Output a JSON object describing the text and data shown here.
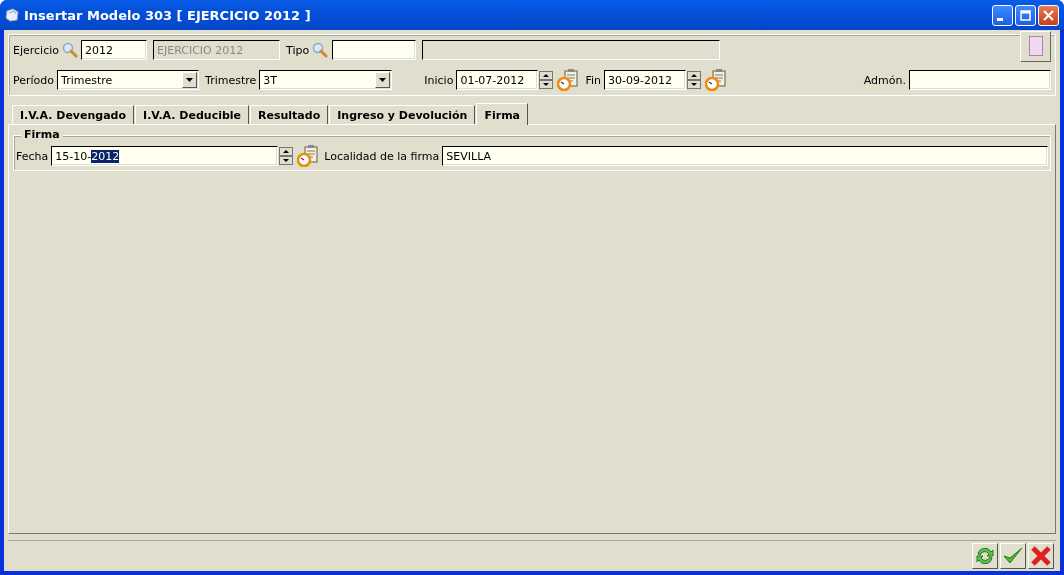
{
  "window": {
    "title": "Insertar Modelo 303 [ EJERCICIO 2012 ]"
  },
  "header": {
    "ejercicio": {
      "label": "Ejercicio",
      "value": "2012",
      "description": "EJERCICIO 2012"
    },
    "tipo": {
      "label": "Tipo"
    },
    "periodo": {
      "label": "Período",
      "value": "Trimestre"
    },
    "trimestre": {
      "label": "Trimestre",
      "value": "3T"
    },
    "inicio": {
      "label": "Inicio",
      "value": "01-07-2012"
    },
    "fin": {
      "label": "Fin",
      "value": "30-09-2012"
    },
    "admon": {
      "label": "Admón."
    }
  },
  "tabs": [
    {
      "label": "I.V.A. Devengado",
      "selected": false
    },
    {
      "label": "I.V.A. Deducible",
      "selected": false
    },
    {
      "label": "Resultado",
      "selected": false
    },
    {
      "label": "Ingreso y Devolución",
      "selected": false
    },
    {
      "label": "Firma",
      "selected": true
    }
  ],
  "firma": {
    "title": "Firma",
    "fecha_label": "Fecha",
    "fecha_parts": [
      {
        "text": "15-10-",
        "selected": false
      },
      {
        "text": "2012",
        "selected": true
      }
    ],
    "localidad_label": "Localidad de la firma",
    "localidad": "SEVILLA"
  },
  "footer_buttons": [
    {
      "kind": "refresh"
    },
    {
      "kind": "accept"
    },
    {
      "kind": "cancel"
    }
  ]
}
